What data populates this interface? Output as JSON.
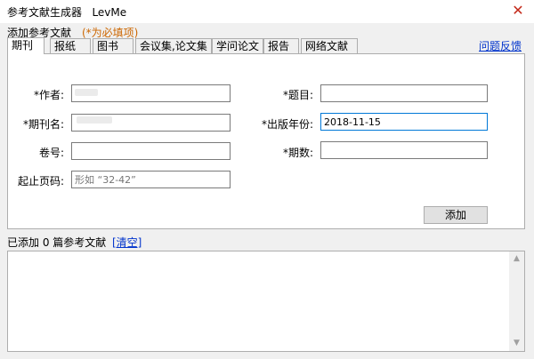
{
  "window": {
    "title": "参考文献生成器   LevMe",
    "close_glyph": "✕",
    "accent_close": "#c42b1c"
  },
  "header": {
    "section_label": "添加参考文献",
    "required_note": "(*为必填项)",
    "feedback_link": "问题反馈"
  },
  "tabs": [
    {
      "label": "期刊",
      "active": true
    },
    {
      "label": "报纸"
    },
    {
      "label": "图书"
    },
    {
      "label": "会议集,论文集"
    },
    {
      "label": "学问论文"
    },
    {
      "label": "报告"
    },
    {
      "label": "网络文献"
    }
  ],
  "form": {
    "author_label": "*作者:",
    "author_value": "",
    "title_label": "*题目:",
    "title_value": "",
    "journal_label": "*期刊名:",
    "journal_value": "",
    "year_label": "*出版年份:",
    "year_value": "2018-11-15",
    "volume_label": "卷号:",
    "volume_value": "",
    "issue_label": "*期数:",
    "issue_value": "",
    "pages_label": "起止页码:",
    "pages_placeholder": "形如 “32-42”",
    "add_button": "添加"
  },
  "list": {
    "status": "已添加 0 篇参考文献",
    "clear_link": "[清空]",
    "content": ""
  }
}
